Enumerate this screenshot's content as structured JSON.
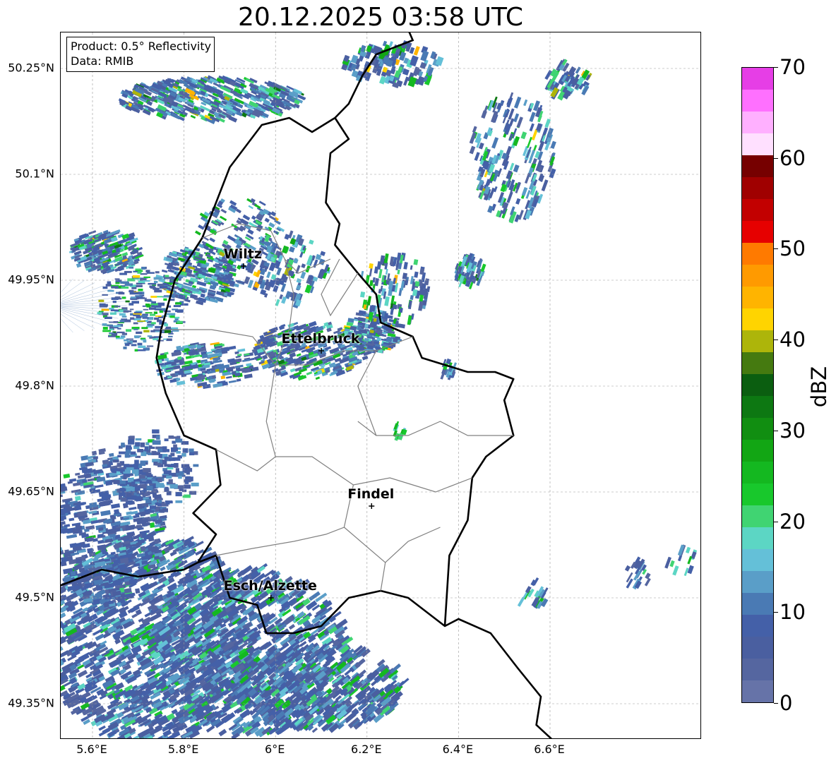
{
  "title": "20.12.2025 03:58 UTC",
  "info": {
    "product": "Product: 0.5° Reflectivity",
    "data": "Data: RMIB"
  },
  "extent": {
    "lon_min": 5.4,
    "lon_max": 6.8,
    "lat_min": 49.3,
    "lat_max": 50.3
  },
  "lat_ticks": [
    {
      "value": 50.25,
      "label": "50.25°N"
    },
    {
      "value": 50.1,
      "label": "50.1°N"
    },
    {
      "value": 49.95,
      "label": "49.95°N"
    },
    {
      "value": 49.8,
      "label": "49.8°N"
    },
    {
      "value": 49.65,
      "label": "49.65°N"
    },
    {
      "value": 49.5,
      "label": "49.5°N"
    },
    {
      "value": 49.35,
      "label": "49.35°N"
    }
  ],
  "lon_ticks": [
    {
      "value": 5.6,
      "label": "5.6°E"
    },
    {
      "value": 5.8,
      "label": "5.8°E"
    },
    {
      "value": 6.0,
      "label": "6°E"
    },
    {
      "value": 6.2,
      "label": "6.2°E"
    },
    {
      "value": 6.4,
      "label": "6.4°E"
    },
    {
      "value": 6.6,
      "label": "6.6°E"
    }
  ],
  "cities": [
    {
      "name": "Wiltz",
      "lon": 5.93,
      "lat": 49.97
    },
    {
      "name": "Ettelbruck",
      "lon": 6.1,
      "lat": 49.85
    },
    {
      "name": "Findel",
      "lon": 6.21,
      "lat": 49.63
    },
    {
      "name": "Esch/Alzette",
      "lon": 5.99,
      "lat": 49.5
    }
  ],
  "radar_site": {
    "lon": 5.505,
    "lat": 49.914,
    "color": "#e31a1c"
  },
  "colorbar": {
    "label": "dBZ",
    "ticks": [
      "0",
      "10",
      "20",
      "30",
      "40",
      "50",
      "60",
      "70"
    ],
    "min": 0,
    "max": 70,
    "colors": [
      "#6673a8",
      "#5566a0",
      "#4a5fa0",
      "#4460a8",
      "#4a7ab4",
      "#5a9ec8",
      "#64c0d8",
      "#5cd6c4",
      "#40d472",
      "#18c82c",
      "#14b820",
      "#12a614",
      "#118e11",
      "#0d7812",
      "#0b5e10",
      "#457a10",
      "#adb50a",
      "#ffd400",
      "#ffb400",
      "#ff9a00",
      "#ff7a00",
      "#e60000",
      "#c20000",
      "#a00000",
      "#760000",
      "#ffe0ff",
      "#ffb0ff",
      "#ff70ff",
      "#e63ee6"
    ]
  }
}
